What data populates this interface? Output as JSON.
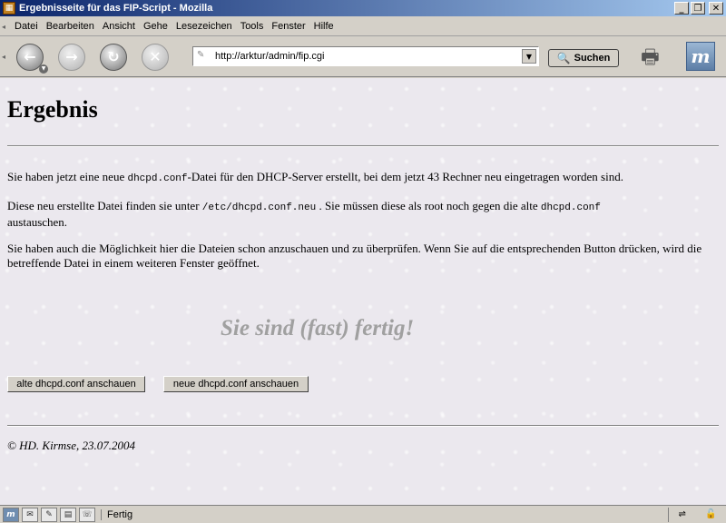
{
  "window": {
    "title": "Ergebnisseite für das FIP-Script - Mozilla"
  },
  "menu": [
    {
      "label": "Datei"
    },
    {
      "label": "Bearbeiten"
    },
    {
      "label": "Ansicht"
    },
    {
      "label": "Gehe"
    },
    {
      "label": "Lesezeichen"
    },
    {
      "label": "Tools"
    },
    {
      "label": "Fenster"
    },
    {
      "label": "Hilfe"
    }
  ],
  "toolbar": {
    "url": "http://arktur/admin/fip.cgi",
    "search_label": "Suchen"
  },
  "page": {
    "heading": "Ergebnis",
    "p1_a": "Sie haben jetzt eine neue ",
    "p1_code": "dhcpd.conf",
    "p1_b": "-Datei für den DHCP-Server erstellt, bei dem jetzt 43 Rechner neu eingetragen worden sind.",
    "p2_a": "Diese neu erstellte Datei finden sie unter ",
    "p2_code1": "/etc/dhcpd.conf.neu",
    "p2_b": " . Sie müssen diese als root noch gegen die alte ",
    "p2_code2": "dhcpd.conf",
    "p2_c": "austauschen.",
    "p3": "Sie haben auch die Möglichkeit hier die Dateien schon anzuschauen und zu überprüfen. Wenn Sie auf die entsprechenden Button drücken, wird die betreffende Datei in einem weiteren Fenster geöffnet.",
    "slogan": "Sie sind (fast) fertig!",
    "btn_old": "alte dhcpd.conf anschauen",
    "btn_new": "neue dhcpd.conf anschauen",
    "footer": "© HD. Kirmse, 23.07.2004"
  },
  "status": {
    "text": "Fertig"
  }
}
